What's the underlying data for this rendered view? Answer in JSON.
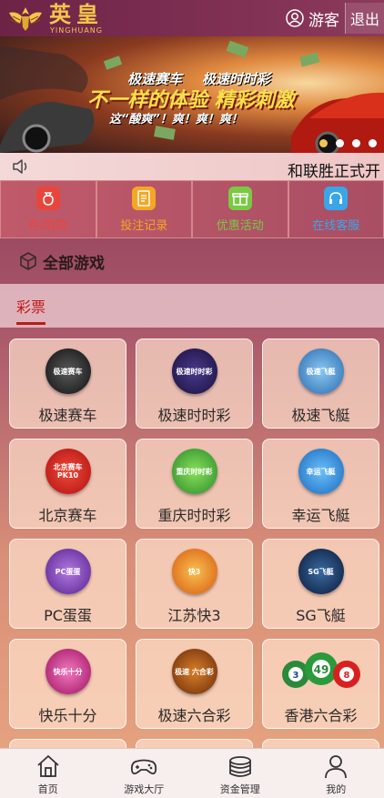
{
  "header": {
    "logo_cn": "英皇",
    "logo_en": "YINGHUANG",
    "guest_label": "游客",
    "logout_label": "退出"
  },
  "banner": {
    "line1a": "极速赛车",
    "line1b": "极速时时彩",
    "line2": "不一样的体验 精彩刺激",
    "line3": "这“酸爽”！爽！爽！爽！",
    "slides": 4,
    "active_slide": 1
  },
  "notice": {
    "text": "和联胜正式开"
  },
  "quick_actions": [
    {
      "label": "存/取款",
      "icon": "money-bag-icon",
      "color": "#e8463c"
    },
    {
      "label": "投注记录",
      "icon": "document-icon",
      "color": "#f5a623"
    },
    {
      "label": "优惠活动",
      "icon": "gift-icon",
      "color": "#7ac943"
    },
    {
      "label": "在线客服",
      "icon": "headset-icon",
      "color": "#3aa6e8"
    }
  ],
  "games_title": "全部游戏",
  "tabs": [
    {
      "label": "彩票",
      "active": true
    }
  ],
  "games": [
    {
      "name": "极速赛车",
      "icon": "speed-racing-icon",
      "color": "#1a1a1a",
      "badge": "极速赛车"
    },
    {
      "name": "极速时时彩",
      "icon": "speed-lottery-icon",
      "color": "#2a2050",
      "badge": "极速时时彩"
    },
    {
      "name": "极速飞艇",
      "icon": "speed-boat-icon",
      "color": "#3a7ac8",
      "badge": "极速飞艇"
    },
    {
      "name": "北京赛车",
      "icon": "beijing-racing-icon",
      "color": "#d8201a",
      "badge": "北京赛车 PK10"
    },
    {
      "name": "重庆时时彩",
      "icon": "chongqing-lottery-icon",
      "color": "#3aa83a",
      "badge": "重庆时时彩"
    },
    {
      "name": "幸运飞艇",
      "icon": "lucky-boat-icon",
      "color": "#2a88d8",
      "badge": "幸运飞艇"
    },
    {
      "name": "PC蛋蛋",
      "icon": "pc-egg-icon",
      "color": "#7a3ab0",
      "badge": "PC蛋蛋"
    },
    {
      "name": "江苏快3",
      "icon": "jiangsu-k3-icon",
      "color": "#f08a1a",
      "badge": "快3"
    },
    {
      "name": "SG飞艇",
      "icon": "sg-boat-icon",
      "color": "#1a3a6a",
      "badge": "SG飞艇"
    },
    {
      "name": "快乐十分",
      "icon": "happy-ten-icon",
      "color": "#c8207a",
      "badge": "快乐十分"
    },
    {
      "name": "极速六合彩",
      "icon": "speed-mark-six-icon",
      "color": "#8a3a10",
      "badge": "极速 六合彩"
    },
    {
      "name": "香港六合彩",
      "icon": "hk-mark-six-icon",
      "color": "#ffffff",
      "badge": ""
    }
  ],
  "hk_balls": [
    "3",
    "49",
    "8"
  ],
  "bottom_nav": [
    {
      "label": "首页",
      "icon": "home-icon"
    },
    {
      "label": "游戏大厅",
      "icon": "gamepad-icon"
    },
    {
      "label": "资金管理",
      "icon": "coins-icon"
    },
    {
      "label": "我的",
      "icon": "person-icon"
    }
  ]
}
